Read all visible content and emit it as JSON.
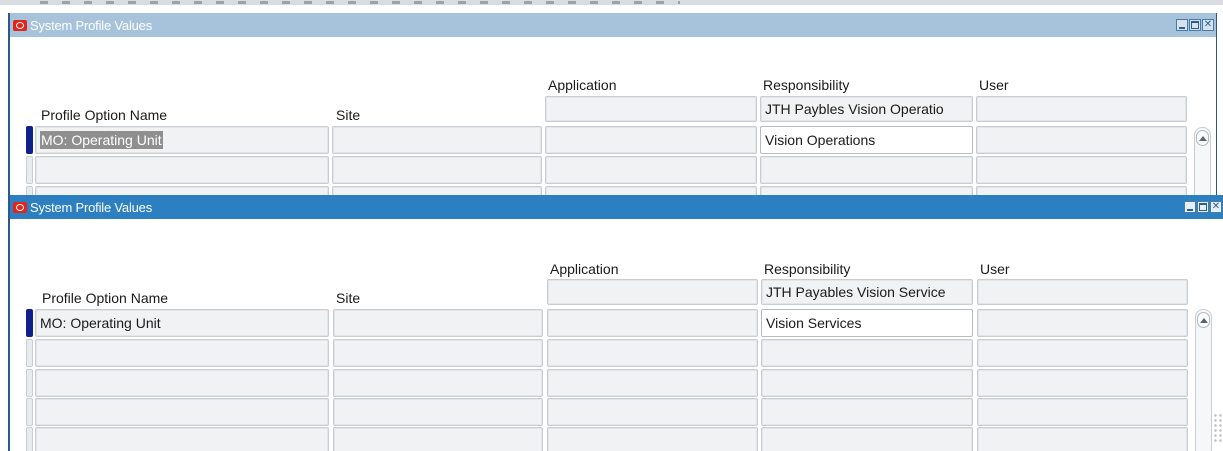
{
  "windows": [
    {
      "title": "System Profile Values",
      "headers": {
        "profile_option_name": "Profile Option Name",
        "site": "Site",
        "application": "Application",
        "responsibility": "Responsibility",
        "user": "User"
      },
      "context": {
        "responsibility": "JTH Paybles Vision Operatio"
      },
      "rows": [
        {
          "profile_option_name": "MO: Operating Unit",
          "responsibility": "Vision Operations"
        }
      ]
    },
    {
      "title": "System Profile Values",
      "headers": {
        "profile_option_name": "Profile Option Name",
        "site": "Site",
        "application": "Application",
        "responsibility": "Responsibility",
        "user": "User"
      },
      "context": {
        "responsibility": "JTH Payables Vision Service"
      },
      "rows": [
        {
          "profile_option_name": "MO: Operating Unit",
          "responsibility": "Vision Services"
        }
      ]
    }
  ],
  "icons": {
    "app": "oracle-logo-icon",
    "minimize": "minimize-icon",
    "maximize": "maximize-icon",
    "close": "close-icon",
    "scroll_up": "scroll-up-arrow-icon"
  },
  "colors": {
    "inactive_titlebar": "#a6c3db",
    "active_titlebar": "#2c7fc1",
    "record_indicator": "#10208a",
    "oracle_red": "#e3241b"
  }
}
